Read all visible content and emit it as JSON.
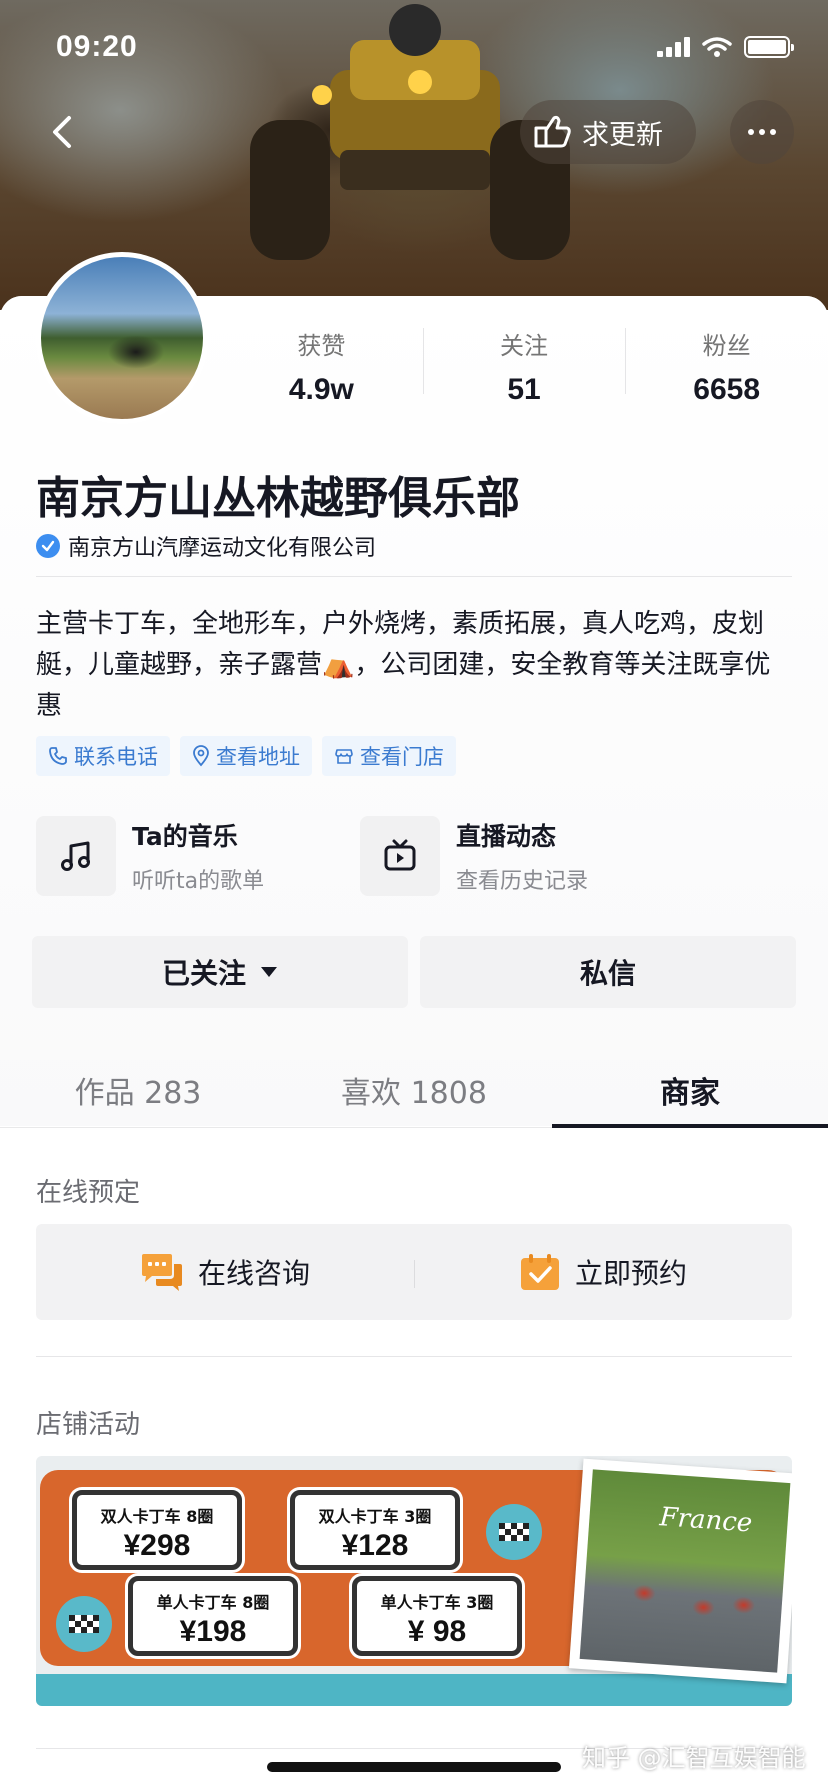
{
  "status_bar": {
    "time": "09:20"
  },
  "header": {
    "update_label": "求更新"
  },
  "profile": {
    "stats": [
      {
        "label": "获赞",
        "value": "4.9w"
      },
      {
        "label": "关注",
        "value": "51"
      },
      {
        "label": "粉丝",
        "value": "6658"
      }
    ],
    "name": "南京方山丛林越野俱乐部",
    "verification": "南京方山汽摩运动文化有限公司",
    "bio": "主营卡丁车，全地形车，户外烧烤，素质拓展，真人吃鸡，皮划艇，儿童越野，亲子露营⛺，公司团建，安全教育等关注既享优惠",
    "chips": [
      {
        "label": "联系电话",
        "icon": "phone-icon"
      },
      {
        "label": "查看地址",
        "icon": "location-icon"
      },
      {
        "label": "查看门店",
        "icon": "store-icon"
      }
    ],
    "cards": [
      {
        "title": "Ta的音乐",
        "subtitle": "听听ta的歌单",
        "icon": "music-note-icon"
      },
      {
        "title": "直播动态",
        "subtitle": "查看历史记录",
        "icon": "live-tv-icon"
      }
    ],
    "follow_label": "已关注",
    "message_label": "私信"
  },
  "tabs": [
    {
      "label": "作品 283",
      "active": false
    },
    {
      "label": "喜欢 1808",
      "active": false
    },
    {
      "label": "商家",
      "active": true
    }
  ],
  "merchant": {
    "booking_title": "在线预定",
    "consult_label": "在线咨询",
    "reserve_label": "立即预约",
    "activity_title": "店铺活动",
    "promo": {
      "tags": [
        {
          "title": "双人卡丁车 8圈",
          "price": "¥298"
        },
        {
          "title": "双人卡丁车 3圈",
          "price": "¥128"
        },
        {
          "title": "单人卡丁车 8圈",
          "price": "¥198"
        },
        {
          "title": "单人卡丁车 3圈",
          "price": "¥ 98"
        }
      ],
      "photo_caption": "France"
    }
  },
  "watermark": "知乎 @汇智互娱智能",
  "colors": {
    "accent_blue": "#3b7bd0",
    "verify_blue": "#3d8ef0",
    "booking_icon_orange": "#f5a13a",
    "promo_orange": "#d8662c",
    "promo_teal": "#4eb5c5"
  }
}
